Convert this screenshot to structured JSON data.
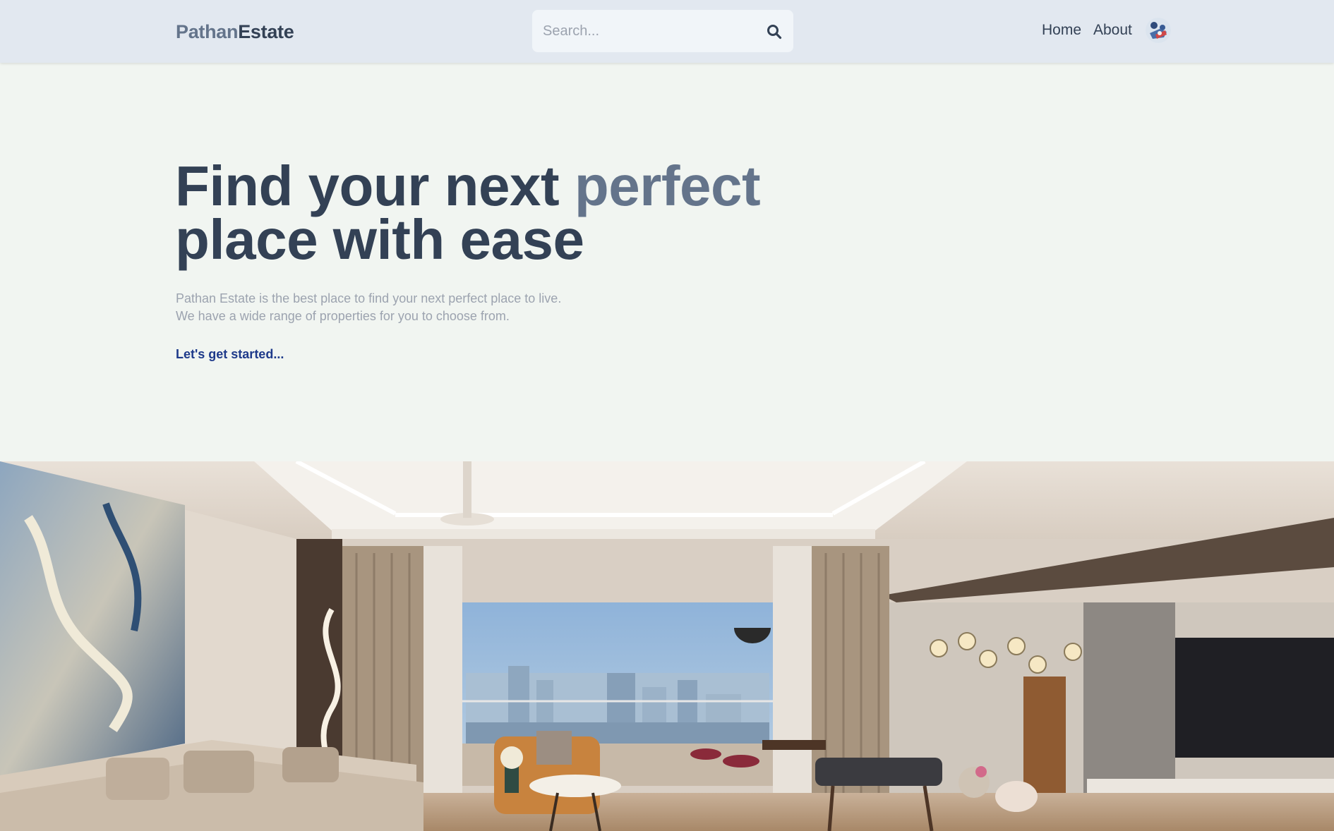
{
  "header": {
    "logo": {
      "part1": "Pathan",
      "part2": "Estate"
    },
    "search": {
      "placeholder": "Search...",
      "icon": "search-icon"
    },
    "nav": [
      {
        "label": "Home"
      },
      {
        "label": "About"
      }
    ],
    "avatar_icon": "avatar"
  },
  "hero": {
    "title_part1": "Find your next ",
    "title_accent": "perfect",
    "title_part2": "place with ease",
    "description_line1": "Pathan Estate is the best place to find your next perfect place to live.",
    "description_line2": "We have a wide range of properties for you to choose from.",
    "cta": "Let's get started..."
  },
  "colors": {
    "header_bg": "#e2e8f0",
    "page_bg": "#f1f5f1",
    "text_dark": "#334155",
    "text_accent": "#64748b",
    "text_muted": "#9ca3af",
    "link": "#1e3a8a"
  }
}
